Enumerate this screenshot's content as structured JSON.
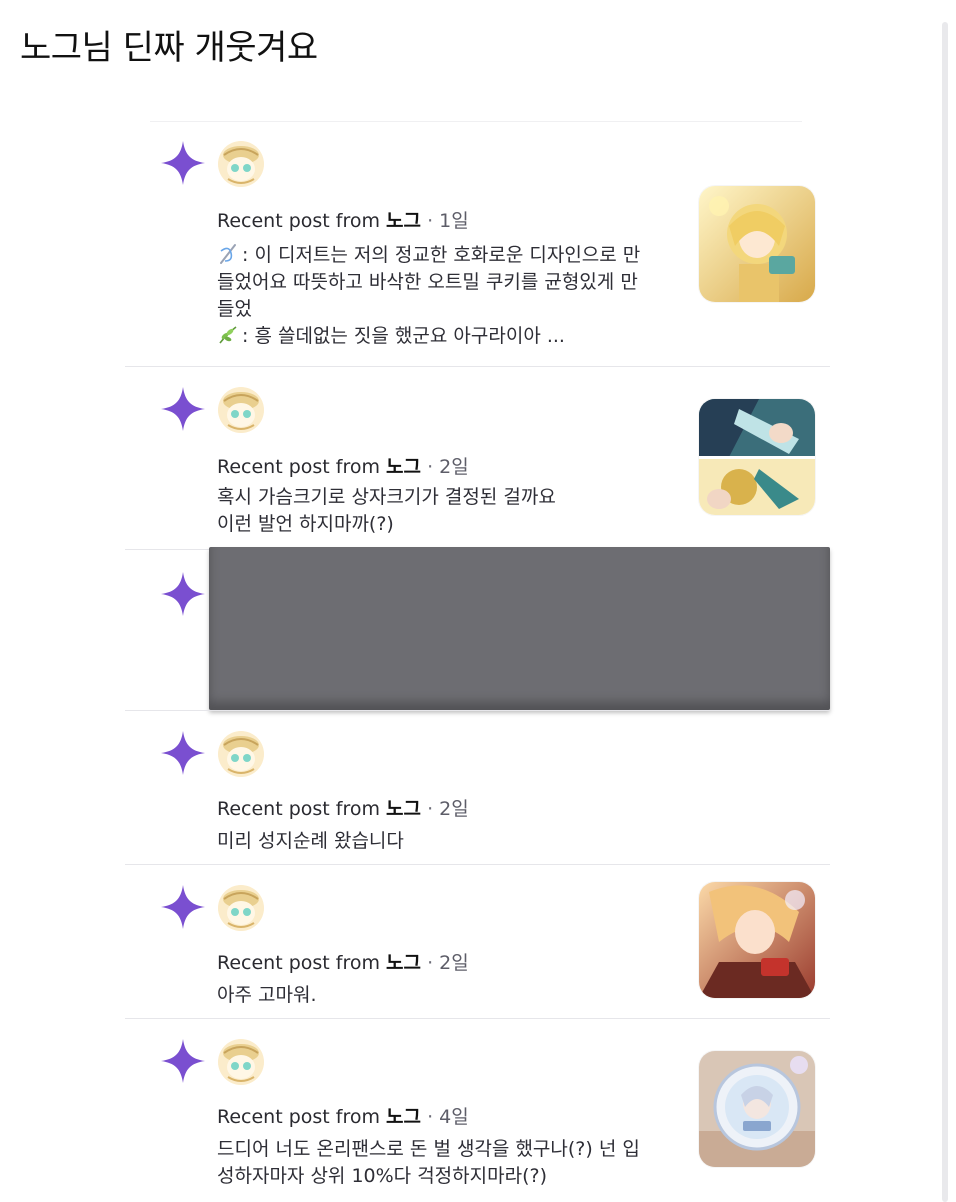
{
  "page": {
    "title": "노그님 딘짜 개웃겨요"
  },
  "feed": [
    {
      "prefix": "Recent post from",
      "author": "노그",
      "separator": "·",
      "age": "1일",
      "lines": [
        "이 디저트는 저의 정교한 호화로운 디자인으로 만",
        "들었어요 따뜻하고 바삭한 오트밀 쿠키를 균형있게 만",
        "들었",
        "흥 쓸데없는 짓을 했군요 아구라이아 ..."
      ],
      "line1_prefix": ": ",
      "line4_prefix": ": ",
      "line1_icon": "needle-thread-icon",
      "line4_icon": "herb-leaf-icon",
      "thumbnail": "character-golden-thumbnail"
    },
    {
      "prefix": "Recent post from",
      "author": "노그",
      "separator": "·",
      "age": "2일",
      "lines": [
        "혹시 가슴크기로 상자크기가 결정된 걸까요",
        "이런 발언 하지마까(?)"
      ],
      "thumbnail": "character-split-thumbnail"
    },
    {
      "redacted": true
    },
    {
      "prefix": "Recent post from",
      "author": "노그",
      "separator": "·",
      "age": "2일",
      "lines": [
        "미리 성지순례 왔습니다"
      ]
    },
    {
      "prefix": "Recent post from",
      "author": "노그",
      "separator": "·",
      "age": "2일",
      "lines": [
        "아주 고마워."
      ],
      "thumbnail": "character-blonde-thumbnail"
    },
    {
      "prefix": "Recent post from",
      "author": "노그",
      "separator": "·",
      "age": "4일",
      "lines": [
        "드디어 너도 온리팬스로 돈 벌 생각을 했구나(?) 넌 입",
        "성하자마자 상위 10%다 걱정하지마라(?)"
      ],
      "thumbnail": "plate-merch-thumbnail"
    }
  ],
  "colors": {
    "sparkle": "#7a4fd0",
    "divider": "#e6e6ea",
    "text": "#2e2e36",
    "redacted": "#6d6d72"
  },
  "icons": {
    "sparkle": "sparkle-icon",
    "avatar": "explorer-avatar-icon"
  }
}
